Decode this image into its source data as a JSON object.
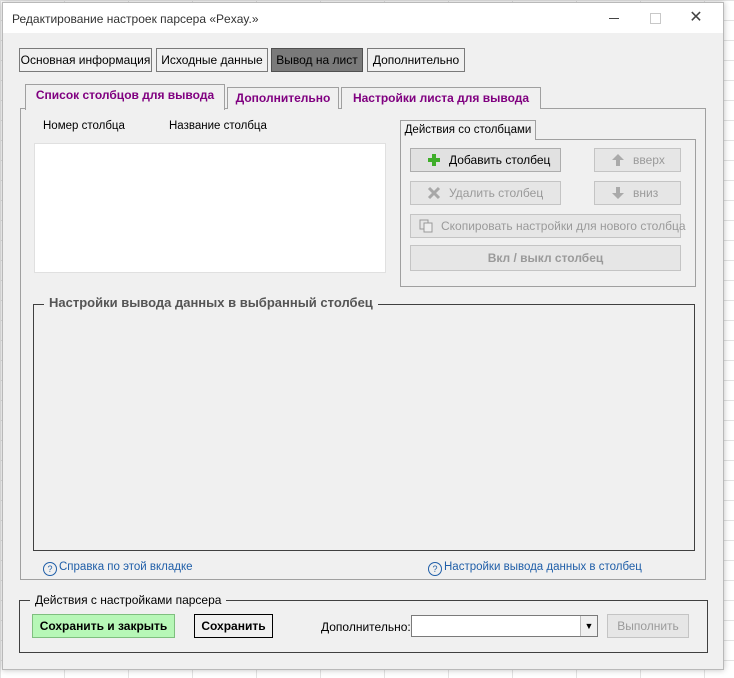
{
  "window": {
    "title": "Редактирование настроек парсера «Pexay.»",
    "close_glyph": "✕"
  },
  "main_tabs": [
    {
      "label": "Основная информация"
    },
    {
      "label": "Исходные данные"
    },
    {
      "label": "Вывод на лист",
      "active": true
    },
    {
      "label": "Дополнительно"
    }
  ],
  "sub_tabs": [
    {
      "label": "Список столбцов для вывода",
      "active": true
    },
    {
      "label": "Дополнительно"
    },
    {
      "label": "Настройки листа для вывода"
    }
  ],
  "columns_list": {
    "headers": [
      "Номер столбца",
      "Название столбца"
    ]
  },
  "column_actions": {
    "tab_label": "Действия со столбцами",
    "add": "Добавить столбец",
    "up": "вверх",
    "delete": "Удалить столбец",
    "down": "вниз",
    "copy": "Скопировать настройки для нового столбца",
    "toggle": "Вкл / выкл столбец"
  },
  "output_settings": {
    "title": "Настройки вывода данных в выбранный столбец"
  },
  "help_links": {
    "tab_help": "Справка по этой вкладке",
    "column_help": "Настройки вывода данных в столбец"
  },
  "parser_actions": {
    "title": "Действия с настройками парсера",
    "save_close": "Сохранить и закрыть",
    "save": "Сохранить",
    "extra_label": "Дополнительно:",
    "extra_value": "",
    "execute": "Выполнить"
  },
  "colors": {
    "accent_tab_text": "#800080",
    "save_close_bg": "#b7f7b7",
    "link": "#1f5ea8",
    "active_tab_bg": "#7a7a7a"
  }
}
